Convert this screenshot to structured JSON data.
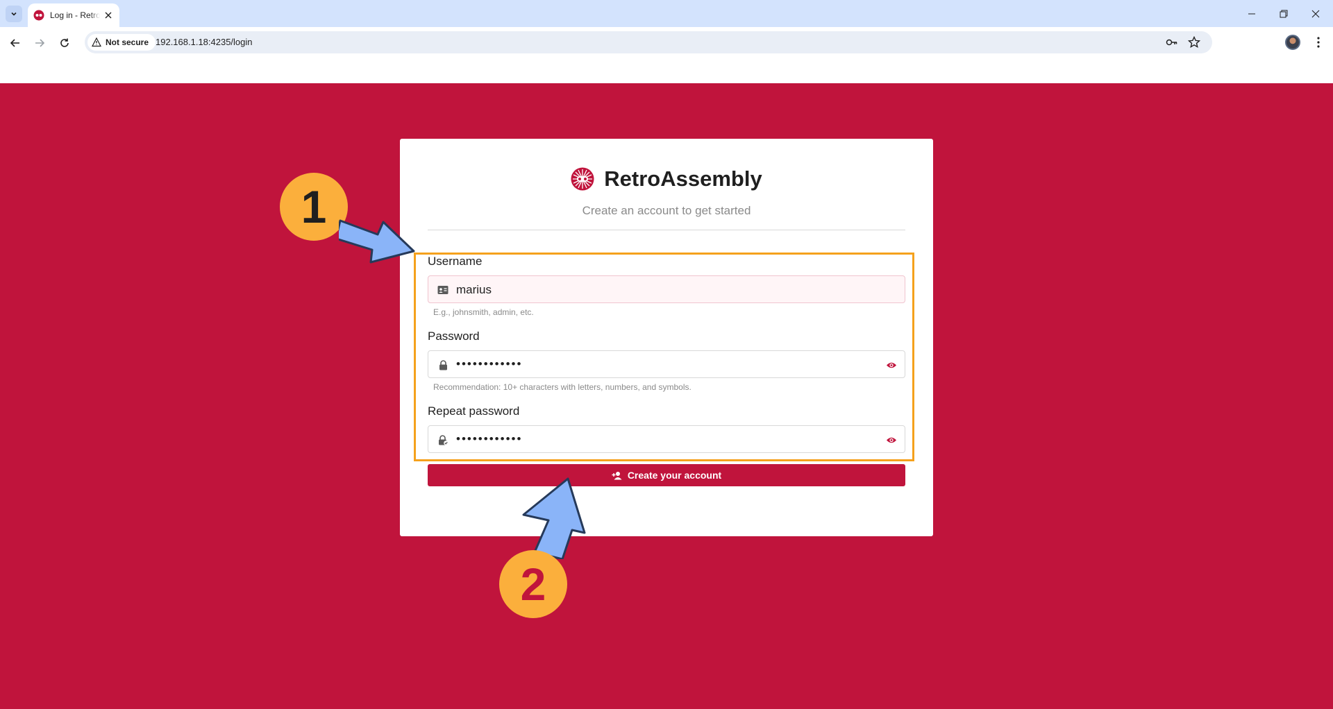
{
  "browser": {
    "tab_title": "Log in - RetroAssembly",
    "security_label": "Not secure",
    "url": "192.168.1.18:4235/login"
  },
  "colors": {
    "brand": "#c0143c",
    "highlight": "#f5a11c",
    "badge": "#fbaf3c",
    "arrow": "#8ab4f8"
  },
  "brand": {
    "name": "RetroAssembly",
    "subtitle": "Create an account to get started"
  },
  "form": {
    "username": {
      "label": "Username",
      "value": "marius",
      "hint": "E.g., johnsmith, admin, etc.",
      "icon": "id-card-icon"
    },
    "password": {
      "label": "Password",
      "value": "••••••••••••",
      "hint": "Recommendation: 10+ characters with letters, numbers, and symbols.",
      "icon": "lock-icon"
    },
    "repeat_password": {
      "label": "Repeat password",
      "value": "••••••••••••",
      "icon": "lock-check-icon"
    },
    "submit_label": "Create your account"
  },
  "annotations": {
    "step1": "1",
    "step2": "2"
  }
}
